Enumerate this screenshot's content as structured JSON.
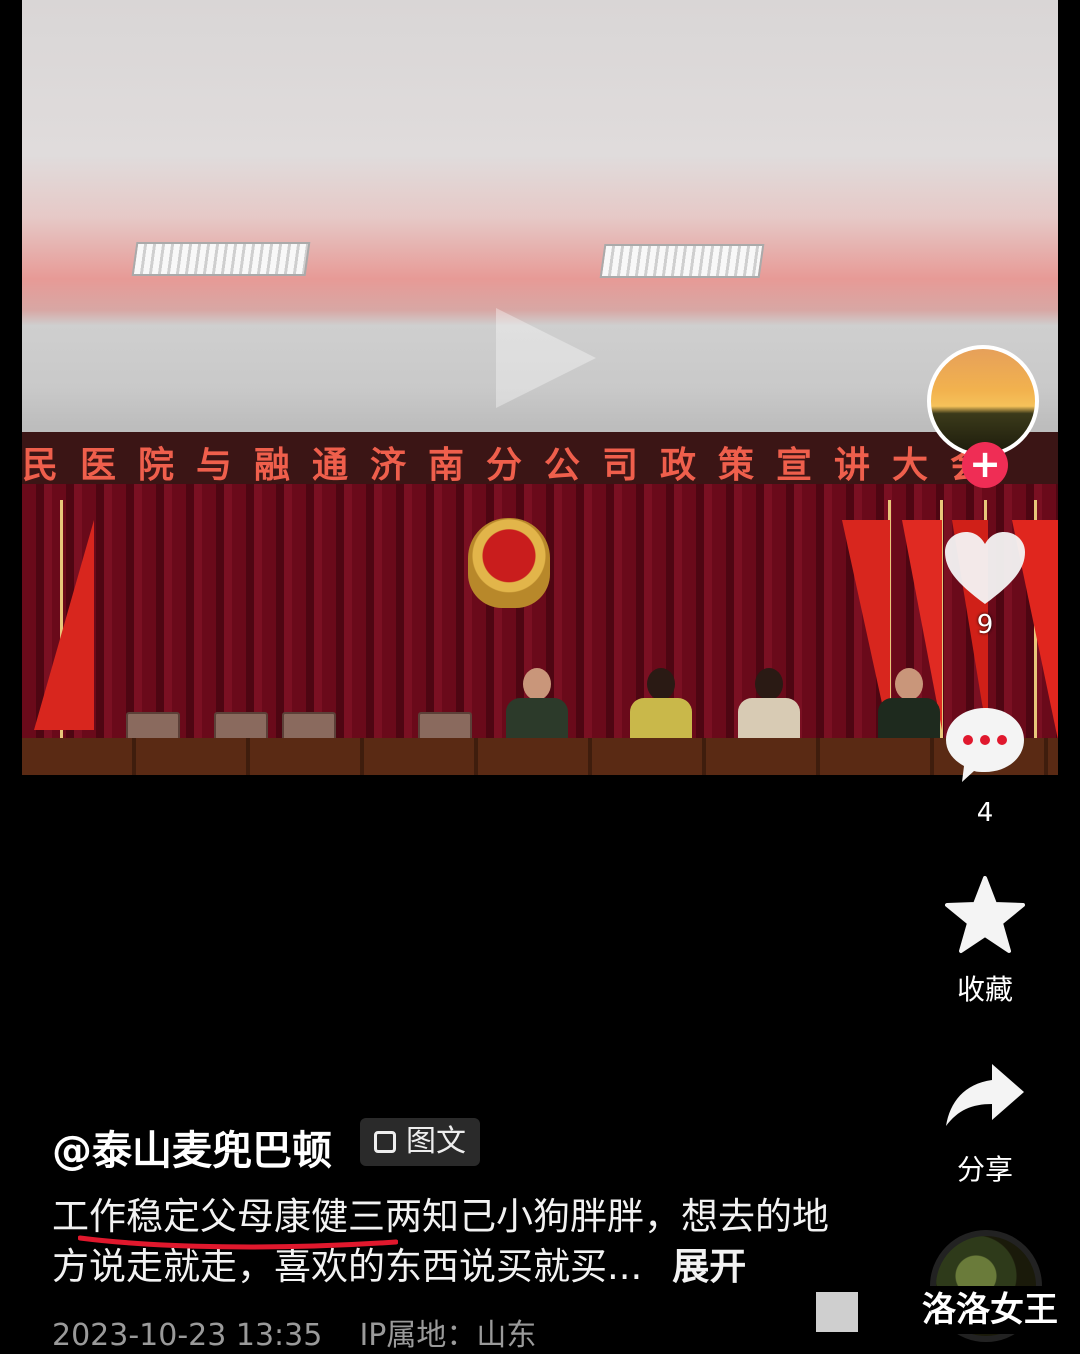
{
  "photo": {
    "banner_text": "民医院与融通济南分公司政策宣讲大会"
  },
  "side_actions": {
    "like_count": "9",
    "comment_count": "4",
    "favorite_label": "收藏",
    "share_label": "分享",
    "follow_symbol": "+"
  },
  "post": {
    "author": "@泰山麦兜巴顿",
    "type_tag": "图文",
    "description": "工作稳定父母康健三两知己小狗胖胖，想去的地方说走就走，喜欢的东西说买就买...",
    "expand_label": "展开",
    "timestamp": "2023-10-23 13:35",
    "ip_location": "IP属地：山东"
  },
  "watermark": "洛洛女王",
  "colors": {
    "follow_red": "#ef2d55",
    "underline_red": "#e0182d",
    "meta_gray": "#9a9a9a"
  }
}
